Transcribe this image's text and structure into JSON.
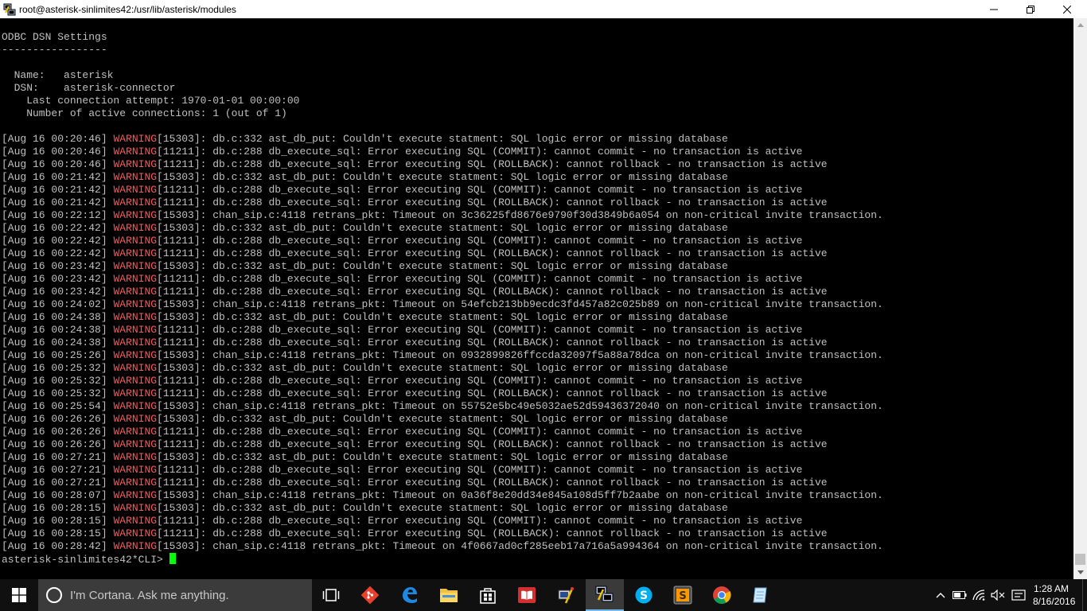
{
  "window": {
    "title": "root@asterisk-sinlimites42:/usr/lib/asterisk/modules",
    "icon": "putty-icon",
    "controls": {
      "minimize": "minimize-icon",
      "maximize": "restore-icon",
      "close": "close-icon"
    }
  },
  "terminal": {
    "header_lines": [
      "ODBC DSN Settings",
      "-----------------",
      "",
      "  Name:   asterisk",
      "  DSN:    asterisk-connector",
      "    Last connection attempt: 1970-01-01 00:00:00",
      "    Number of active connections: 1 (out of 1)",
      ""
    ],
    "log_lines": [
      {
        "ts": "[Aug 16 00:20:46]",
        "level": "WARNING",
        "pid": "[15303]",
        "msg": ": db.c:332 ast_db_put: Couldn't execute statment: SQL logic error or missing database"
      },
      {
        "ts": "[Aug 16 00:20:46]",
        "level": "WARNING",
        "pid": "[11211]",
        "msg": ": db.c:288 db_execute_sql: Error executing SQL (COMMIT): cannot commit - no transaction is active"
      },
      {
        "ts": "[Aug 16 00:20:46]",
        "level": "WARNING",
        "pid": "[11211]",
        "msg": ": db.c:288 db_execute_sql: Error executing SQL (ROLLBACK): cannot rollback - no transaction is active"
      },
      {
        "ts": "[Aug 16 00:21:42]",
        "level": "WARNING",
        "pid": "[15303]",
        "msg": ": db.c:332 ast_db_put: Couldn't execute statment: SQL logic error or missing database"
      },
      {
        "ts": "[Aug 16 00:21:42]",
        "level": "WARNING",
        "pid": "[11211]",
        "msg": ": db.c:288 db_execute_sql: Error executing SQL (COMMIT): cannot commit - no transaction is active"
      },
      {
        "ts": "[Aug 16 00:21:42]",
        "level": "WARNING",
        "pid": "[11211]",
        "msg": ": db.c:288 db_execute_sql: Error executing SQL (ROLLBACK): cannot rollback - no transaction is active"
      },
      {
        "ts": "[Aug 16 00:22:12]",
        "level": "WARNING",
        "pid": "[15303]",
        "msg": ": chan_sip.c:4118 retrans_pkt: Timeout on 3c36225fd8676e9790f30d3849b6a054 on non-critical invite transaction."
      },
      {
        "ts": "[Aug 16 00:22:42]",
        "level": "WARNING",
        "pid": "[15303]",
        "msg": ": db.c:332 ast_db_put: Couldn't execute statment: SQL logic error or missing database"
      },
      {
        "ts": "[Aug 16 00:22:42]",
        "level": "WARNING",
        "pid": "[11211]",
        "msg": ": db.c:288 db_execute_sql: Error executing SQL (COMMIT): cannot commit - no transaction is active"
      },
      {
        "ts": "[Aug 16 00:22:42]",
        "level": "WARNING",
        "pid": "[11211]",
        "msg": ": db.c:288 db_execute_sql: Error executing SQL (ROLLBACK): cannot rollback - no transaction is active"
      },
      {
        "ts": "[Aug 16 00:23:42]",
        "level": "WARNING",
        "pid": "[15303]",
        "msg": ": db.c:332 ast_db_put: Couldn't execute statment: SQL logic error or missing database"
      },
      {
        "ts": "[Aug 16 00:23:42]",
        "level": "WARNING",
        "pid": "[11211]",
        "msg": ": db.c:288 db_execute_sql: Error executing SQL (COMMIT): cannot commit - no transaction is active"
      },
      {
        "ts": "[Aug 16 00:23:42]",
        "level": "WARNING",
        "pid": "[11211]",
        "msg": ": db.c:288 db_execute_sql: Error executing SQL (ROLLBACK): cannot rollback - no transaction is active"
      },
      {
        "ts": "[Aug 16 00:24:02]",
        "level": "WARNING",
        "pid": "[15303]",
        "msg": ": chan_sip.c:4118 retrans_pkt: Timeout on 54efcb213bb9ecdc3fd457a82c025b89 on non-critical invite transaction."
      },
      {
        "ts": "[Aug 16 00:24:38]",
        "level": "WARNING",
        "pid": "[15303]",
        "msg": ": db.c:332 ast_db_put: Couldn't execute statment: SQL logic error or missing database"
      },
      {
        "ts": "[Aug 16 00:24:38]",
        "level": "WARNING",
        "pid": "[11211]",
        "msg": ": db.c:288 db_execute_sql: Error executing SQL (COMMIT): cannot commit - no transaction is active"
      },
      {
        "ts": "[Aug 16 00:24:38]",
        "level": "WARNING",
        "pid": "[11211]",
        "msg": ": db.c:288 db_execute_sql: Error executing SQL (ROLLBACK): cannot rollback - no transaction is active"
      },
      {
        "ts": "[Aug 16 00:25:26]",
        "level": "WARNING",
        "pid": "[15303]",
        "msg": ": chan_sip.c:4118 retrans_pkt: Timeout on 0932899826ffccda32097f5a88a78dca on non-critical invite transaction."
      },
      {
        "ts": "[Aug 16 00:25:32]",
        "level": "WARNING",
        "pid": "[15303]",
        "msg": ": db.c:332 ast_db_put: Couldn't execute statment: SQL logic error or missing database"
      },
      {
        "ts": "[Aug 16 00:25:32]",
        "level": "WARNING",
        "pid": "[11211]",
        "msg": ": db.c:288 db_execute_sql: Error executing SQL (COMMIT): cannot commit - no transaction is active"
      },
      {
        "ts": "[Aug 16 00:25:32]",
        "level": "WARNING",
        "pid": "[11211]",
        "msg": ": db.c:288 db_execute_sql: Error executing SQL (ROLLBACK): cannot rollback - no transaction is active"
      },
      {
        "ts": "[Aug 16 00:25:54]",
        "level": "WARNING",
        "pid": "[15303]",
        "msg": ": chan_sip.c:4118 retrans_pkt: Timeout on 55752e5bc49e5032ae52d59436372040 on non-critical invite transaction."
      },
      {
        "ts": "[Aug 16 00:26:26]",
        "level": "WARNING",
        "pid": "[15303]",
        "msg": ": db.c:332 ast_db_put: Couldn't execute statment: SQL logic error or missing database"
      },
      {
        "ts": "[Aug 16 00:26:26]",
        "level": "WARNING",
        "pid": "[11211]",
        "msg": ": db.c:288 db_execute_sql: Error executing SQL (COMMIT): cannot commit - no transaction is active"
      },
      {
        "ts": "[Aug 16 00:26:26]",
        "level": "WARNING",
        "pid": "[11211]",
        "msg": ": db.c:288 db_execute_sql: Error executing SQL (ROLLBACK): cannot rollback - no transaction is active"
      },
      {
        "ts": "[Aug 16 00:27:21]",
        "level": "WARNING",
        "pid": "[15303]",
        "msg": ": db.c:332 ast_db_put: Couldn't execute statment: SQL logic error or missing database"
      },
      {
        "ts": "[Aug 16 00:27:21]",
        "level": "WARNING",
        "pid": "[11211]",
        "msg": ": db.c:288 db_execute_sql: Error executing SQL (COMMIT): cannot commit - no transaction is active"
      },
      {
        "ts": "[Aug 16 00:27:21]",
        "level": "WARNING",
        "pid": "[11211]",
        "msg": ": db.c:288 db_execute_sql: Error executing SQL (ROLLBACK): cannot rollback - no transaction is active"
      },
      {
        "ts": "[Aug 16 00:28:07]",
        "level": "WARNING",
        "pid": "[15303]",
        "msg": ": chan_sip.c:4118 retrans_pkt: Timeout on 0a36f8e20dd34e845a108d5ff7b2aabe on non-critical invite transaction."
      },
      {
        "ts": "[Aug 16 00:28:15]",
        "level": "WARNING",
        "pid": "[15303]",
        "msg": ": db.c:332 ast_db_put: Couldn't execute statment: SQL logic error or missing database"
      },
      {
        "ts": "[Aug 16 00:28:15]",
        "level": "WARNING",
        "pid": "[11211]",
        "msg": ": db.c:288 db_execute_sql: Error executing SQL (COMMIT): cannot commit - no transaction is active"
      },
      {
        "ts": "[Aug 16 00:28:15]",
        "level": "WARNING",
        "pid": "[11211]",
        "msg": ": db.c:288 db_execute_sql: Error executing SQL (ROLLBACK): cannot rollback - no transaction is active"
      },
      {
        "ts": "[Aug 16 00:28:42]",
        "level": "WARNING",
        "pid": "[15303]",
        "msg": ": chan_sip.c:4118 retrans_pkt: Timeout on 4f0667ad0cf285eeb17a716a5a994364 on non-critical invite transaction."
      }
    ],
    "prompt": "asterisk-sinlimites42*CLI> ",
    "colors": {
      "text": "#c0c0c0",
      "warning": "#ff5555",
      "cursor": "#00ff00",
      "background": "#000000"
    }
  },
  "taskbar": {
    "start_icon": "windows-logo-icon",
    "search_placeholder": "I'm Cortana. Ask me anything.",
    "apps": [
      {
        "name": "task-view-icon"
      },
      {
        "name": "git-icon"
      },
      {
        "name": "edge-icon"
      },
      {
        "name": "file-explorer-icon"
      },
      {
        "name": "store-icon"
      },
      {
        "name": "reader-icon"
      },
      {
        "name": "network-tool-icon"
      },
      {
        "name": "putty-icon"
      },
      {
        "name": "skype-icon"
      },
      {
        "name": "sublime-icon"
      },
      {
        "name": "chrome-icon"
      },
      {
        "name": "notepad-icon"
      }
    ],
    "tray": {
      "icons": [
        "chevron-up-icon",
        "battery-icon",
        "wifi-icon",
        "volume-muted-icon",
        "keyboard-icon"
      ],
      "time": "1:28 AM",
      "date": "8/16/2016"
    }
  }
}
